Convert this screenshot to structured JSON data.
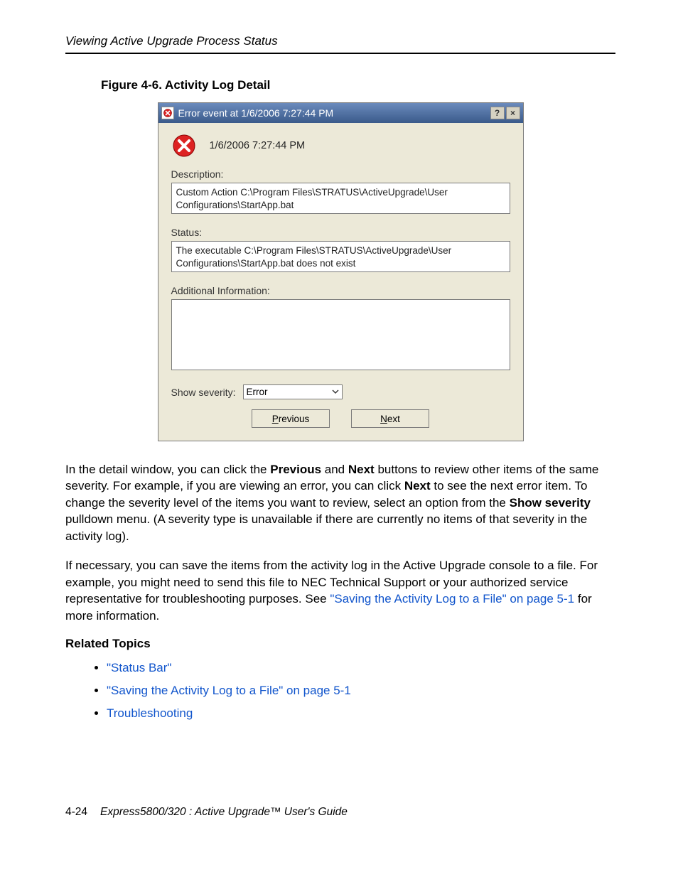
{
  "header": {
    "running": "Viewing Active Upgrade Process Status"
  },
  "figure": {
    "caption": "Figure 4-6. Activity Log Detail"
  },
  "dialog": {
    "title": "Error event at 1/6/2006 7:27:44 PM",
    "help_btn": "?",
    "close_btn": "×",
    "timestamp": "1/6/2006 7:27:44 PM",
    "labels": {
      "description": "Description:",
      "status": "Status:",
      "additional": "Additional Information:",
      "show_severity": "Show severity:"
    },
    "description_text": "Custom Action C:\\Program Files\\STRATUS\\ActiveUpgrade\\User Configurations\\StartApp.bat",
    "status_text": "The executable C:\\Program Files\\STRATUS\\ActiveUpgrade\\User Configurations\\StartApp.bat does not exist",
    "additional_text": "",
    "severity_value": "Error",
    "buttons": {
      "prev": "Previous",
      "prev_ul": "P",
      "next": "ext",
      "next_ul": "N"
    }
  },
  "body": {
    "p1a": "In the detail window, you can click the ",
    "p1b": "Previous",
    "p1c": " and ",
    "p1d": "Next",
    "p1e": " buttons to review other items of the same severity. For example, if you are viewing an error, you can click ",
    "p1f": "Next",
    "p1g": " to see the next error item. To change the severity level of the items you want to review, select an option from the ",
    "p1h": "Show severity",
    "p1i": " pulldown menu. (A severity type is unavailable if there are currently no items of that severity in the activity log).",
    "p2a": "If necessary, you can save the items from the activity log in the Active Upgrade console to a file. For example, you might need to send this file to NEC Technical Support or your authorized service representative for troubleshooting purposes. See ",
    "p2link": "\"Saving the Activity Log to a File\" on page 5-1",
    "p2b": " for more information."
  },
  "related": {
    "heading": "Related Topics",
    "items": [
      "\"Status Bar\"",
      "\"Saving the Activity Log to a File\" on page 5-1",
      "Troubleshooting"
    ]
  },
  "footer": {
    "page": "4-24",
    "title": "Express5800/320   : Active Upgrade™ User's Guide"
  }
}
